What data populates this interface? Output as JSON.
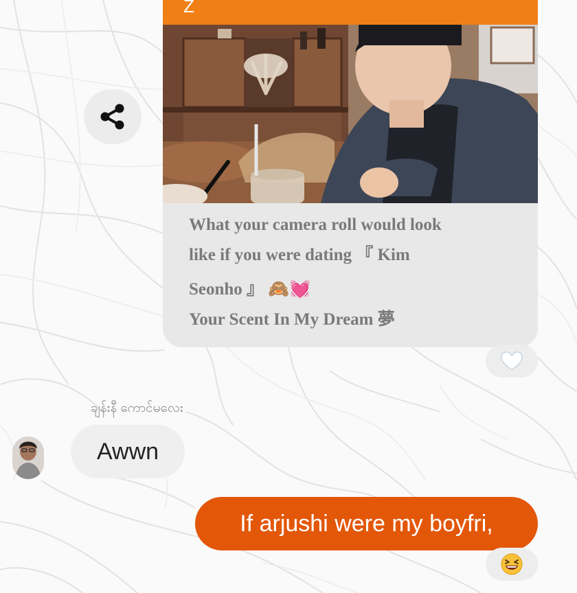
{
  "shared_post": {
    "header_glyph": "Z",
    "caption_line1": "What your camera roll would look",
    "caption_line2": "like if you were dating 『 Kim",
    "caption_line3": "Seonho 』 🙈💓",
    "caption_line4": "Your Scent In My Dream 夢",
    "reaction": "🤍"
  },
  "share_button": {
    "icon": "share-icon"
  },
  "incoming": {
    "sender_name": "ချန်းနီ ကောင်မလေး",
    "message": "Awwn",
    "avatar": "avatar-photo"
  },
  "outgoing": {
    "message": "If arjushi were my boyfri,",
    "reaction": "😆"
  },
  "colors": {
    "header_orange": "#f07f16",
    "outgoing_bubble": "#e35709",
    "card_bg": "#e8e8e8",
    "incoming_bubble": "#efefef"
  }
}
